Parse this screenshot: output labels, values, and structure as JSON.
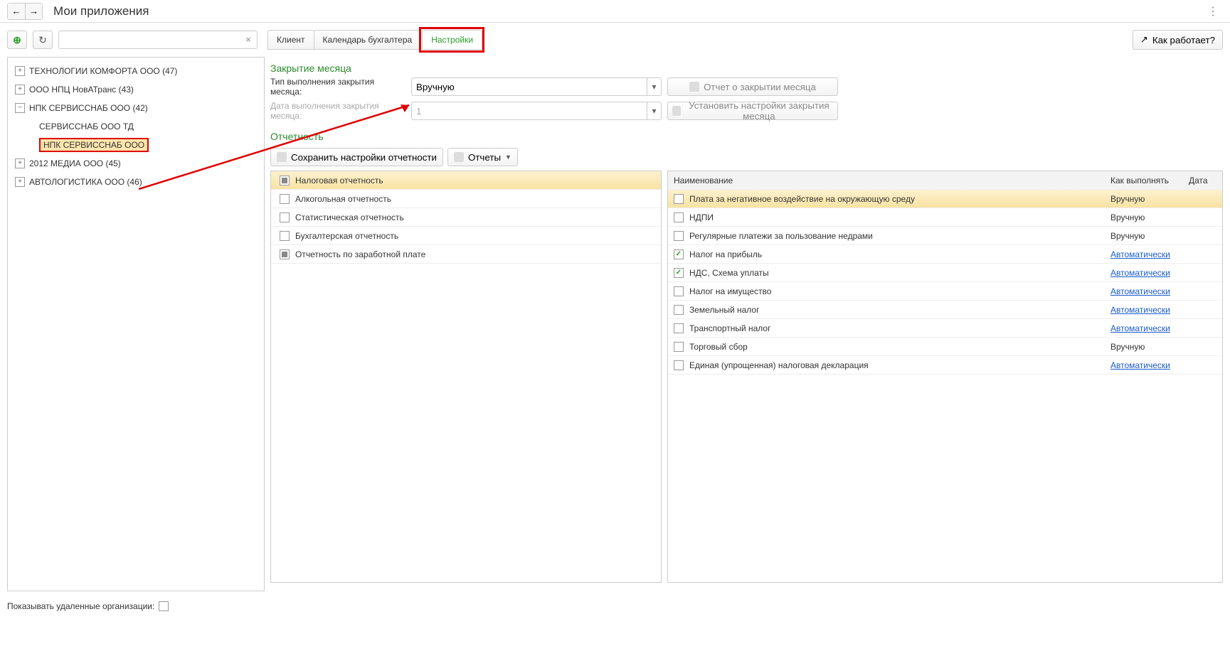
{
  "header": {
    "title": "Мои приложения"
  },
  "toolbar": {
    "search_value": ""
  },
  "sidebar": {
    "items": [
      {
        "label": "ТЕХНОЛОГИИ КОМФОРТА ООО (47)"
      },
      {
        "label": "ООО НПЦ НовАТранс (43)"
      },
      {
        "label": "НПК СЕРВИССНАБ ООО (42)"
      },
      {
        "label": "СЕРВИССНАБ ООО ТД"
      },
      {
        "label": "НПК СЕРВИССНАБ ООО"
      },
      {
        "label": "2012 МЕДИА ООО (45)"
      },
      {
        "label": "АВТОЛОГИСТИКА ООО (46)"
      }
    ]
  },
  "tabs": {
    "t0": "Клиент",
    "t1": "Календарь бухгалтера",
    "t2": "Настройки"
  },
  "help_label": "Как работает?",
  "closing": {
    "title": "Закрытие месяца",
    "type_label": "Тип выполнения закрытия месяца:",
    "type_value": "Вручную",
    "date_label": "Дата выполнения закрытия месяца:",
    "date_value": "1",
    "report_btn": "Отчет о закрытии месяца",
    "settings_btn": "Установить настройки закрытия месяца"
  },
  "reporting": {
    "title": "Отчетность",
    "save_btn": "Сохранить настройки отчетности",
    "reports_btn": "Отчеты"
  },
  "categories": [
    {
      "label": "Налоговая отчетность",
      "state": "indet"
    },
    {
      "label": "Алкогольная отчетность",
      "state": "off"
    },
    {
      "label": "Статистическая отчетность",
      "state": "off"
    },
    {
      "label": "Бухгалтерская отчетность",
      "state": "off"
    },
    {
      "label": "Отчетность по заработной плате",
      "state": "indet"
    }
  ],
  "grid": {
    "h_name": "Наименование",
    "h_how": "Как выполнять",
    "h_date": "Дата",
    "rows": [
      {
        "name": "Плата за негативное воздействие на окружающую среду",
        "how": "Вручную",
        "link": false,
        "checked": false,
        "sel": true
      },
      {
        "name": "НДПИ",
        "how": "Вручную",
        "link": false,
        "checked": false
      },
      {
        "name": "Регулярные платежи за пользование недрами",
        "how": "Вручную",
        "link": false,
        "checked": false
      },
      {
        "name": "Налог на прибыль",
        "how": "Автоматически",
        "link": true,
        "checked": true
      },
      {
        "name": "НДС, Схема уплаты",
        "how": "Автоматически",
        "link": true,
        "checked": true
      },
      {
        "name": "Налог на имущество",
        "how": "Автоматически",
        "link": true,
        "checked": false
      },
      {
        "name": "Земельный налог",
        "how": "Автоматически",
        "link": true,
        "checked": false
      },
      {
        "name": "Транспортный налог",
        "how": "Автоматически",
        "link": true,
        "checked": false
      },
      {
        "name": "Торговый сбор",
        "how": "Вручную",
        "link": false,
        "checked": false
      },
      {
        "name": "Единая (упрощенная) налоговая декларация",
        "how": "Автоматически",
        "link": true,
        "checked": false
      }
    ]
  },
  "footer": {
    "label": "Показывать удаленные организации:"
  }
}
